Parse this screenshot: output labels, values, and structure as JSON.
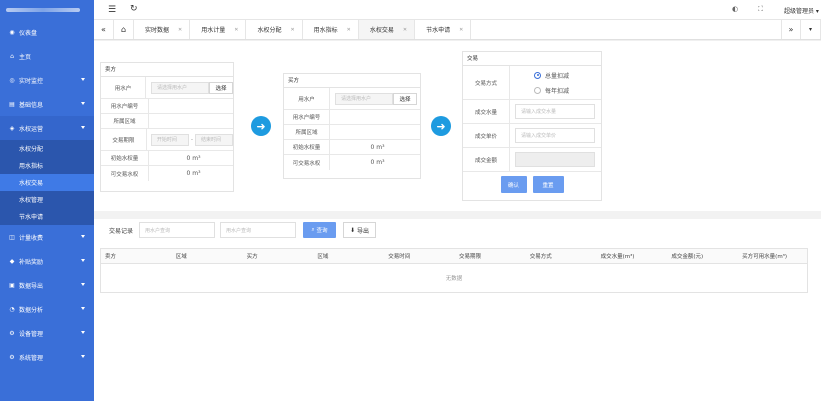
{
  "sidebar": {
    "items": [
      {
        "label": "仪表盘",
        "icon": "dashboard-icon",
        "arrow": false
      },
      {
        "label": "主页",
        "icon": "home-icon",
        "arrow": false
      },
      {
        "label": "实时监控",
        "icon": "monitor-icon",
        "arrow": true
      },
      {
        "label": "基础信息",
        "icon": "info-icon",
        "arrow": true
      },
      {
        "label": "水权运营",
        "icon": "water-icon",
        "arrow": true,
        "open": true
      }
    ],
    "sub_items": [
      {
        "label": "水权分配",
        "active": false
      },
      {
        "label": "用水指标",
        "active": false
      },
      {
        "label": "水权交易",
        "active": true
      },
      {
        "label": "水权管理",
        "active": false
      },
      {
        "label": "节水申请",
        "active": false
      }
    ],
    "items_after": [
      {
        "label": "计量收费",
        "icon": "billing-icon"
      },
      {
        "label": "补贴奖励",
        "icon": "reward-icon"
      },
      {
        "label": "数据导出",
        "icon": "export-icon"
      },
      {
        "label": "数据分析",
        "icon": "analysis-icon"
      },
      {
        "label": "设备管理",
        "icon": "device-icon"
      },
      {
        "label": "系统管理",
        "icon": "settings-icon"
      }
    ]
  },
  "topbar": {
    "user": "超级管理员"
  },
  "tabs": [
    {
      "label": "实时数据",
      "active": false
    },
    {
      "label": "用水计量",
      "active": false
    },
    {
      "label": "水权分配",
      "active": false
    },
    {
      "label": "用水指标",
      "active": false
    },
    {
      "label": "水权交易",
      "active": true
    },
    {
      "label": "节水申请",
      "active": false
    }
  ],
  "seller": {
    "title": "卖方",
    "user_label": "用水户",
    "user_placeholder": "请选择用水户",
    "select_label": "选择",
    "code_label": "用水户编号",
    "region_label": "所属区域",
    "period_label": "交易期限",
    "start_placeholder": "开始时间",
    "end_placeholder": "结束时间",
    "initial_label": "初始水权量",
    "initial_value": "0 m³",
    "tradable_label": "可交易水权",
    "tradable_value": "0 m³"
  },
  "buyer": {
    "title": "买方",
    "user_label": "用水户",
    "user_placeholder": "请选择用水户",
    "select_label": "选择",
    "code_label": "用水户编号",
    "region_label": "所属区域",
    "initial_label": "初始水权量",
    "initial_value": "0 m³",
    "tradable_label": "可交易水权",
    "tradable_value": "0 m³"
  },
  "trade": {
    "title": "交易",
    "method_label": "交易方式",
    "option1": "总量扣减",
    "option2": "每年扣减",
    "qty_label": "成交水量",
    "qty_placeholder": "请输入成交水量",
    "price_label": "成交单价",
    "price_placeholder": "请输入成交单价",
    "amount_label": "成交金额",
    "confirm": "确认",
    "reset": "重置"
  },
  "records": {
    "label": "交易记录",
    "filter1_placeholder": "用水户查询",
    "filter2_placeholder": "用水户查询",
    "query": "查询",
    "export": "导出",
    "columns": [
      "卖方",
      "区域",
      "买方",
      "区域",
      "交易时间",
      "交易期限",
      "交易方式",
      "成交水量(m³)",
      "成交金额(元)",
      "买方可用水量(m³)"
    ],
    "empty": "无数据"
  }
}
